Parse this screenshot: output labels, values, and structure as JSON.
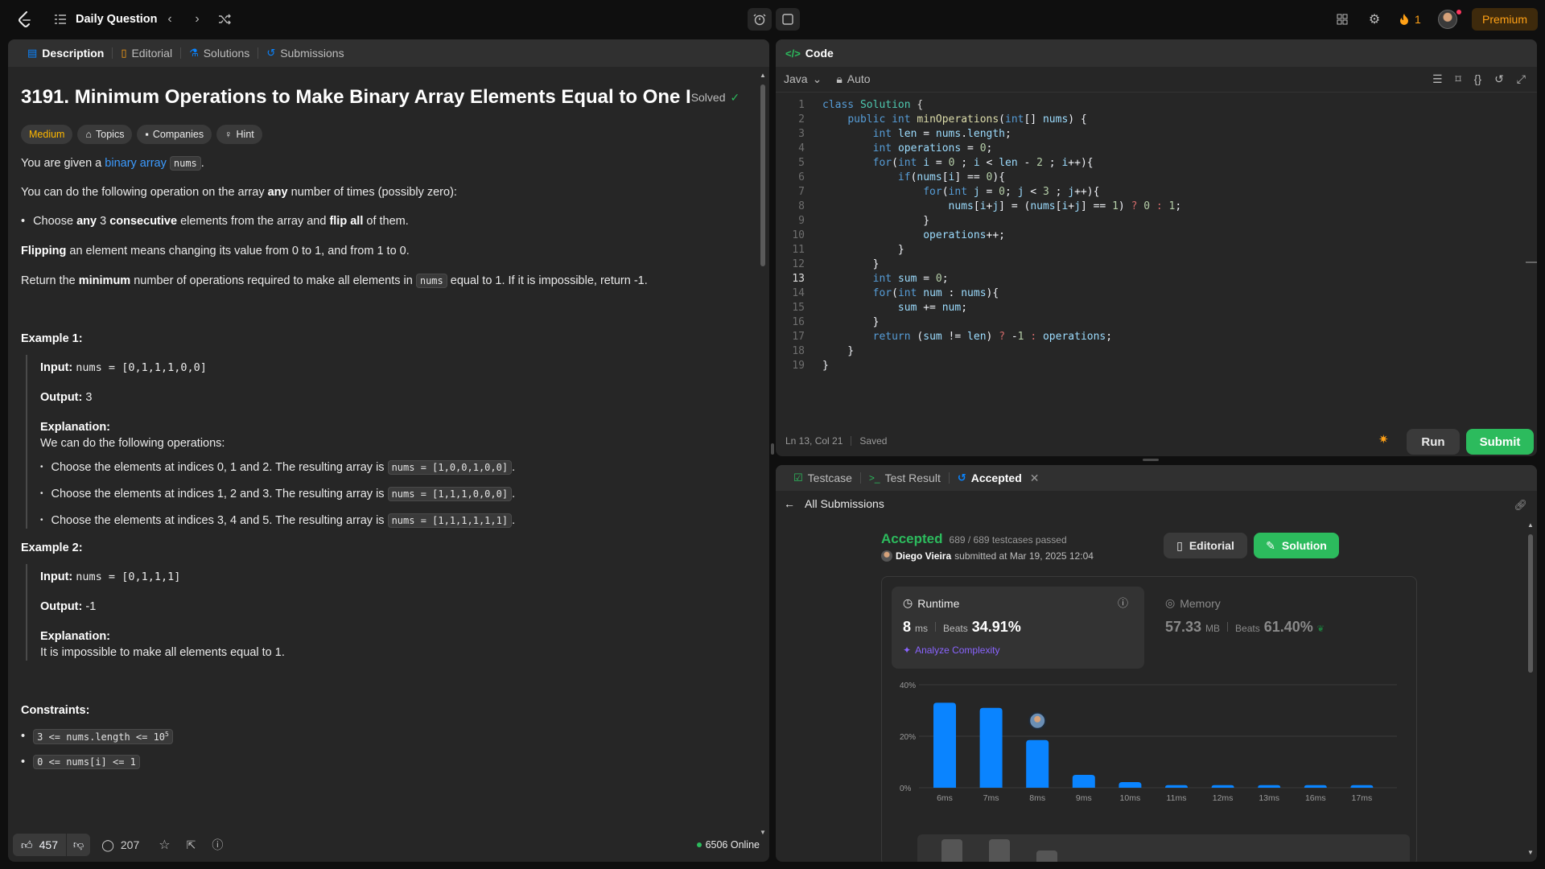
{
  "nav": {
    "title": "Daily Question",
    "streak": "1",
    "premium": "Premium"
  },
  "left": {
    "tabs": [
      "Description",
      "Editorial",
      "Solutions",
      "Submissions"
    ],
    "problem_title": "3191. Minimum Operations to Make Binary Array Elements Equal to One I",
    "solved": "Solved",
    "tags": [
      "Medium",
      "Topics",
      "Companies",
      "Hint"
    ],
    "intro_prefix": "You are given a ",
    "intro_link": "binary array",
    "intro_code": "nums",
    "op_text_a": "You can do the following operation on the array ",
    "op_text_b": "any",
    "op_text_c": " number of times (possibly zero):",
    "bullet_a": "Choose ",
    "bullet_b": "any",
    "bullet_c": " 3 ",
    "bullet_d": "consecutive",
    "bullet_e": " elements from the array and ",
    "bullet_f": "flip all",
    "bullet_g": " of them.",
    "flip_a": "Flipping",
    "flip_b": " an element means changing its value from 0 to 1, and from 1 to 0.",
    "ret_a": "Return the ",
    "ret_b": "minimum",
    "ret_c": " number of operations required to make all elements in ",
    "ret_code": "nums",
    "ret_d": " equal to 1. If it is impossible, return -1.",
    "ex1_title": "Example 1:",
    "ex1_input_label": "Input:",
    "ex1_input": "nums = [0,1,1,1,0,0]",
    "ex1_output_label": "Output:",
    "ex1_output": "3",
    "ex1_expl_label": "Explanation:",
    "ex1_expl": "We can do the following operations:",
    "ex1_steps": [
      {
        "text": "Choose the elements at indices 0, 1 and 2. The resulting array is ",
        "code": "nums = [1,0,0,1,0,0]"
      },
      {
        "text": "Choose the elements at indices 1, 2 and 3. The resulting array is ",
        "code": "nums = [1,1,1,0,0,0]"
      },
      {
        "text": "Choose the elements at indices 3, 4 and 5. The resulting array is ",
        "code": "nums = [1,1,1,1,1,1]"
      }
    ],
    "ex2_title": "Example 2:",
    "ex2_input_label": "Input:",
    "ex2_input": "nums = [0,1,1,1]",
    "ex2_output_label": "Output:",
    "ex2_output": "-1",
    "ex2_expl_label": "Explanation:",
    "ex2_expl": "It is impossible to make all elements equal to 1.",
    "constraints_title": "Constraints:",
    "c1": "3 <= nums.length <= 10",
    "c1_sup": "5",
    "c2": "0 <= nums[i] <= 1",
    "likes": "457",
    "comments": "207",
    "online": "6506 Online"
  },
  "code": {
    "tab": "Code",
    "lang": "Java",
    "auto": "Auto",
    "status": "Ln 13, Col 21",
    "saved": "Saved",
    "run": "Run",
    "submit": "Submit"
  },
  "result": {
    "tabs": [
      "Testcase",
      "Test Result",
      "Accepted"
    ],
    "back": "All Submissions",
    "status": "Accepted",
    "passed": "689 / 689 testcases passed",
    "user": "Diego Vieira",
    "submitted": "submitted at Mar 19, 2025 12:04",
    "editorial_btn": "Editorial",
    "solution_btn": "Solution",
    "runtime_label": "Runtime",
    "runtime_value": "8",
    "runtime_unit": "ms",
    "beats_label": "Beats",
    "runtime_beats": "34.91%",
    "analyze": "Analyze Complexity",
    "memory_label": "Memory",
    "memory_value": "57.33",
    "memory_unit": "MB",
    "memory_beats": "61.40%"
  },
  "chart_data": {
    "type": "bar",
    "categories": [
      "6ms",
      "7ms",
      "8ms",
      "9ms",
      "10ms",
      "11ms",
      "12ms",
      "13ms",
      "16ms",
      "17ms"
    ],
    "values": [
      33,
      31,
      18.5,
      5,
      2.2,
      1,
      1,
      1,
      1,
      1
    ],
    "ylim": [
      0,
      40
    ],
    "yticks": [
      "40%",
      "20%",
      "0%"
    ],
    "highlight": "8ms"
  },
  "colors": {
    "accent_green": "#2cbb5d",
    "accent_blue": "#0a84ff",
    "medium": "#ffb800",
    "premium": "#ffa116"
  }
}
